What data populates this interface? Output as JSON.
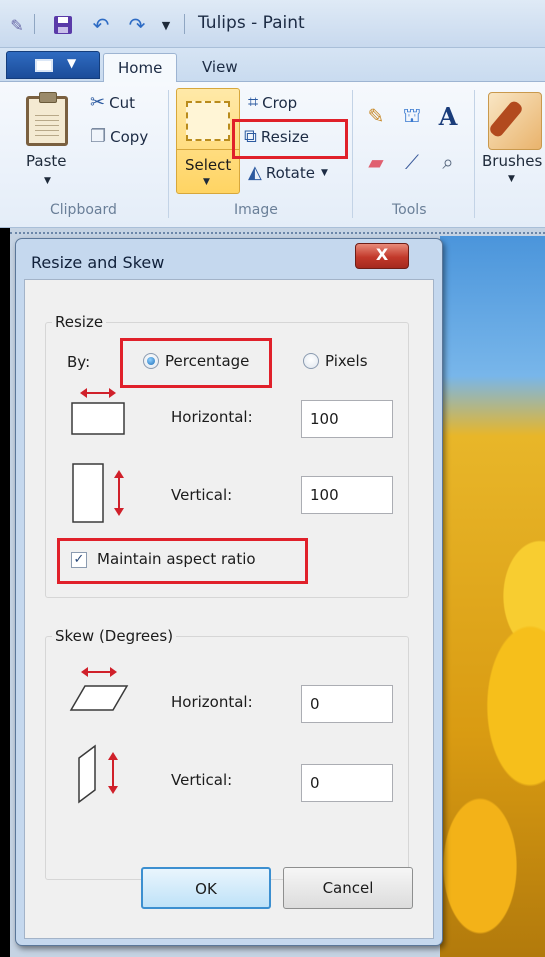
{
  "window": {
    "title": "Tulips - Paint"
  },
  "tabs": [
    {
      "label": "Home"
    },
    {
      "label": "View"
    }
  ],
  "ribbon": {
    "clipboard": {
      "paste_label": "Paste",
      "cut_label": "Cut",
      "copy_label": "Copy",
      "group_label": "Clipboard"
    },
    "image": {
      "select_label": "Select",
      "crop_label": "Crop",
      "resize_label": "Resize",
      "rotate_label": "Rotate",
      "group_label": "Image"
    },
    "tools": {
      "group_label": "Tools"
    },
    "brushes": {
      "label": "Brushes"
    }
  },
  "dialog": {
    "title": "Resize and Skew",
    "close_glyph": "X",
    "resize": {
      "group_title": "Resize",
      "by_label": "By:",
      "percentage_label": "Percentage",
      "pixels_label": "Pixels",
      "selected_unit": "Percentage",
      "horizontal_label": "Horizontal:",
      "horizontal_value": "100",
      "vertical_label": "Vertical:",
      "vertical_value": "100",
      "maintain_label": "Maintain aspect ratio",
      "maintain_checked": true
    },
    "skew": {
      "group_title": "Skew (Degrees)",
      "horizontal_label": "Horizontal:",
      "horizontal_value": "0",
      "vertical_label": "Vertical:",
      "vertical_value": "0"
    },
    "ok_label": "OK",
    "cancel_label": "Cancel"
  },
  "colors": {
    "highlight": "#e0202a",
    "accent": "#3c8fd0"
  }
}
